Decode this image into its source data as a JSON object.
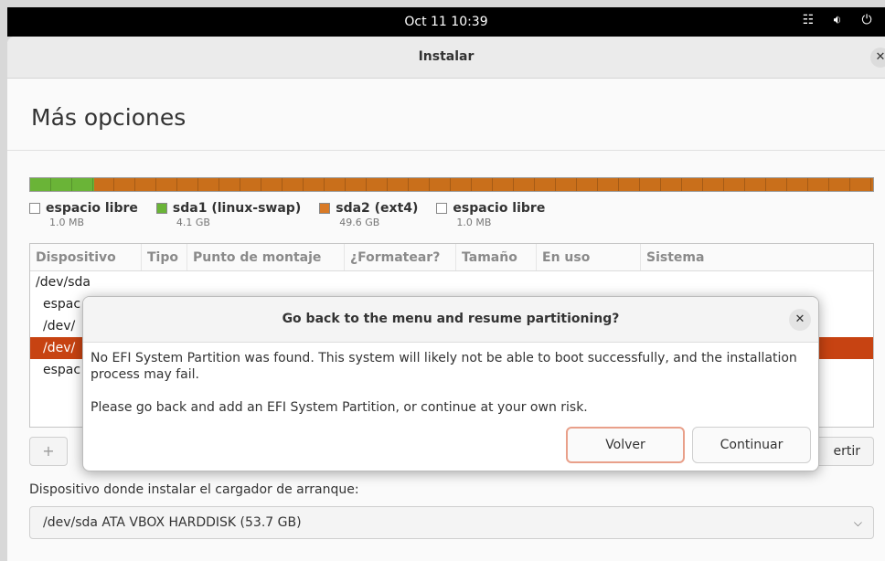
{
  "topbar": {
    "clock": "Oct 11  10:39"
  },
  "window": {
    "title": "Instalar"
  },
  "page": {
    "title": "Más opciones"
  },
  "partition_bar": {
    "segments": [
      {
        "name": "espacio libre",
        "fraction": 0.0,
        "color": "#f8f8f8"
      },
      {
        "name": "sda1 (linux-swap)",
        "fraction": 0.076,
        "color": "#6ab437"
      },
      {
        "name": "sda2 (ext4)",
        "fraction": 0.924,
        "color": "#c96f1b"
      },
      {
        "name": "espacio libre",
        "fraction": 0.0,
        "color": "#f8f8f8"
      }
    ]
  },
  "legend": [
    {
      "label": "espacio libre",
      "size": "1.0 MB",
      "color": "#ffffff"
    },
    {
      "label": "sda1 (linux-swap)",
      "size": "4.1 GB",
      "color": "#6ab437"
    },
    {
      "label": "sda2 (ext4)",
      "size": "49.6 GB",
      "color": "#d97a26"
    },
    {
      "label": "espacio libre",
      "size": "1.0 MB",
      "color": "#ffffff"
    }
  ],
  "table": {
    "headers": [
      "Dispositivo",
      "Tipo",
      "Punto de montaje",
      "¿Formatear?",
      "Tamaño",
      "En uso",
      "Sistema"
    ],
    "rows": [
      "/dev/sda",
      "espac",
      "/dev/",
      "/dev/",
      "espac"
    ]
  },
  "tools": {
    "add": "+",
    "revert": "ertir"
  },
  "boot": {
    "label": "Dispositivo donde instalar el cargador de arranque:",
    "selected": "/dev/sda   ATA VBOX HARDDISK (53.7 GB)"
  },
  "dialog": {
    "title": "Go back to the menu and resume partitioning?",
    "message1": "No EFI System Partition was found. This system will likely not be able to boot successfully, and the installation process may fail.",
    "message2": "Please go back and add an EFI System Partition, or continue at your own risk.",
    "back": "Volver",
    "continue": "Continuar"
  },
  "icons": {
    "network": "network-icon",
    "volume": "volume-icon",
    "power": "power-icon"
  }
}
